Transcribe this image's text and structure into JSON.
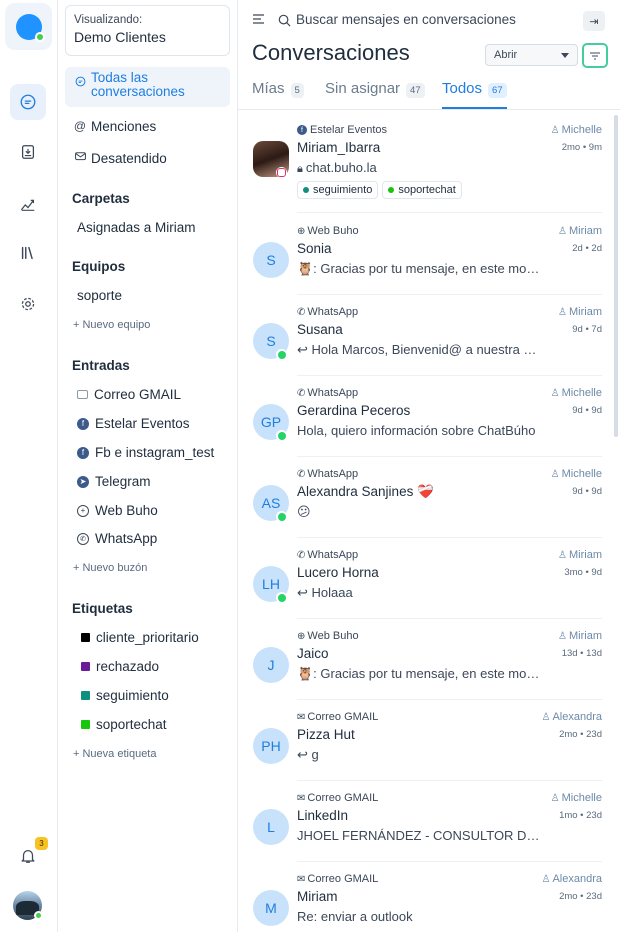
{
  "rail": {
    "notifications_count": "3"
  },
  "account": {
    "viewing_label": "Visualizando:",
    "name": "Demo Clientes"
  },
  "sidebar": {
    "all_conversations": "Todas las conversaciones",
    "all_conversations_line1": "Todas las",
    "all_conversations_line2": "conversaciones",
    "mentions": "Menciones",
    "unattended": "Desatendido",
    "folders_title": "Carpetas",
    "folders": [
      "Asignadas a Miriam"
    ],
    "teams_title": "Equipos",
    "teams": [
      "soporte"
    ],
    "new_team": "Nuevo equipo",
    "inboxes_title": "Entradas",
    "inboxes": [
      {
        "label": "Correo GMAIL",
        "icon": "mail-icon"
      },
      {
        "label": "Estelar Eventos",
        "icon": "facebook-icon"
      },
      {
        "label": "Fb e instagram_test",
        "icon": "facebook-icon"
      },
      {
        "label": "Telegram",
        "icon": "telegram-icon"
      },
      {
        "label": "Web Buho",
        "icon": "globe-icon"
      },
      {
        "label": "WhatsApp",
        "icon": "whatsapp-icon"
      }
    ],
    "new_inbox": "Nuevo buzón",
    "labels_title": "Etiquetas",
    "labels": [
      {
        "label": "cliente_prioritario",
        "color": "#000000"
      },
      {
        "label": "rechazado",
        "color": "#6a1b9a"
      },
      {
        "label": "seguimiento",
        "color": "#0f8f7e"
      },
      {
        "label": "soportechat",
        "color": "#16c60c"
      }
    ],
    "new_label": "Nueva etiqueta"
  },
  "header": {
    "search_placeholder": "Buscar mensajes en conversaciones",
    "title": "Conversaciones",
    "status_value": "Abrir"
  },
  "tabs": [
    {
      "label": "Mías",
      "count": "5"
    },
    {
      "label": "Sin asignar",
      "count": "47"
    },
    {
      "label": "Todos",
      "count": "67"
    }
  ],
  "conversations": [
    {
      "inbox": "Estelar Eventos",
      "inbox_icon": "facebook-icon",
      "agent": "Michelle",
      "name": "Miriam_Ibarra",
      "time": "2mo • 9m",
      "message": "chat.buho.la",
      "initials": "",
      "channel_badge": "instagram-icon",
      "tags": [
        {
          "label": "seguimiento",
          "color": "#0f8f7e"
        },
        {
          "label": "soportechat",
          "color": "#16c60c"
        }
      ]
    },
    {
      "inbox": "Web Buho",
      "inbox_icon": "globe-icon",
      "agent": "Miriam",
      "name": "Sonia",
      "time": "2d • 2d",
      "message": "🦉: Gracias por tu mensaje, en este momento",
      "initials": "S",
      "channel_badge": ""
    },
    {
      "inbox": "WhatsApp",
      "inbox_icon": "whatsapp-icon",
      "agent": "Miriam",
      "name": "Susana",
      "time": "9d • 7d",
      "message": "↩ Hola Marcos, Bienvenid@ a nuestra atención",
      "initials": "S",
      "channel_badge": "whatsapp-icon"
    },
    {
      "inbox": "WhatsApp",
      "inbox_icon": "whatsapp-icon",
      "agent": "Michelle",
      "name": "Gerardina Peceros",
      "time": "9d • 9d",
      "message": "Hola, quiero información sobre ChatBúho",
      "initials": "GP",
      "channel_badge": "whatsapp-icon"
    },
    {
      "inbox": "WhatsApp",
      "inbox_icon": "whatsapp-icon",
      "agent": "Michelle",
      "name": "Alexandra Sanjines ❤️‍🩹",
      "time": "9d • 9d",
      "message": "😕",
      "initials": "AS",
      "channel_badge": "whatsapp-icon"
    },
    {
      "inbox": "WhatsApp",
      "inbox_icon": "whatsapp-icon",
      "agent": "Miriam",
      "name": "Lucero Horna",
      "time": "3mo • 9d",
      "message": "↩ Holaaa",
      "initials": "LH",
      "channel_badge": "whatsapp-icon"
    },
    {
      "inbox": "Web Buho",
      "inbox_icon": "globe-icon",
      "agent": "Miriam",
      "name": "Jaico",
      "time": "13d • 13d",
      "message": "🦉: Gracias por tu mensaje, en este momento",
      "initials": "J",
      "channel_badge": ""
    },
    {
      "inbox": "Correo GMAIL",
      "inbox_icon": "mail-icon",
      "agent": "Alexandra",
      "name": "Pizza Hut",
      "time": "2mo • 23d",
      "message": "↩ g",
      "initials": "PH",
      "channel_badge": ""
    },
    {
      "inbox": "Correo GMAIL",
      "inbox_icon": "mail-icon",
      "agent": "Michelle",
      "name": "LinkedIn",
      "time": "1mo • 23d",
      "message": "JHOEL FERNÁNDEZ - CONSULTOR DIGITAL",
      "initials": "L",
      "channel_badge": ""
    },
    {
      "inbox": "Correo GMAIL",
      "inbox_icon": "mail-icon",
      "agent": "Alexandra",
      "name": "Miriam",
      "time": "2mo • 23d",
      "message": "Re: enviar a outlook",
      "initials": "M",
      "channel_badge": ""
    }
  ]
}
